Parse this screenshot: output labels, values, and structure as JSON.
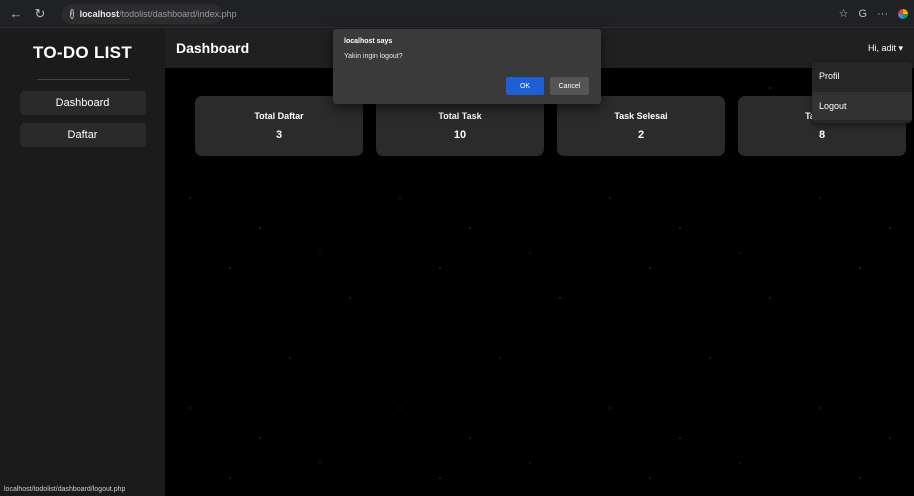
{
  "browser": {
    "back_icon": "←",
    "refresh_icon": "↻",
    "info_icon": "i",
    "url_host": "localhost",
    "url_path": "/todolist/dashboard/index.php",
    "star_icon": "☆",
    "copilot_icon": "G",
    "more_icon": "···"
  },
  "sidebar": {
    "brand": "TO-DO LIST",
    "items": [
      {
        "label": "Dashboard"
      },
      {
        "label": "Daftar"
      }
    ]
  },
  "status_bar": {
    "url": "localhost/todolist/dashboard/logout.php"
  },
  "topbar": {
    "title": "Dashboard",
    "user_menu": "Hi, adit ▾"
  },
  "cards": [
    {
      "label": "Total Daftar",
      "value": "3"
    },
    {
      "label": "Total Task",
      "value": "10"
    },
    {
      "label": "Task Selesai",
      "value": "2"
    },
    {
      "label": "Task Be",
      "value": "8"
    }
  ],
  "dropdown": {
    "items": [
      {
        "label": "Profil"
      },
      {
        "label": "Logout"
      }
    ]
  },
  "dialog": {
    "title": "localhost says",
    "message": "Yakin ingin logout?",
    "ok_label": "OK",
    "cancel_label": "Cancel"
  },
  "colors": {
    "ok_button": "#1e5fd6",
    "sidebar_bg": "#1b1b1b",
    "card_bg": "#2b2b2b"
  }
}
